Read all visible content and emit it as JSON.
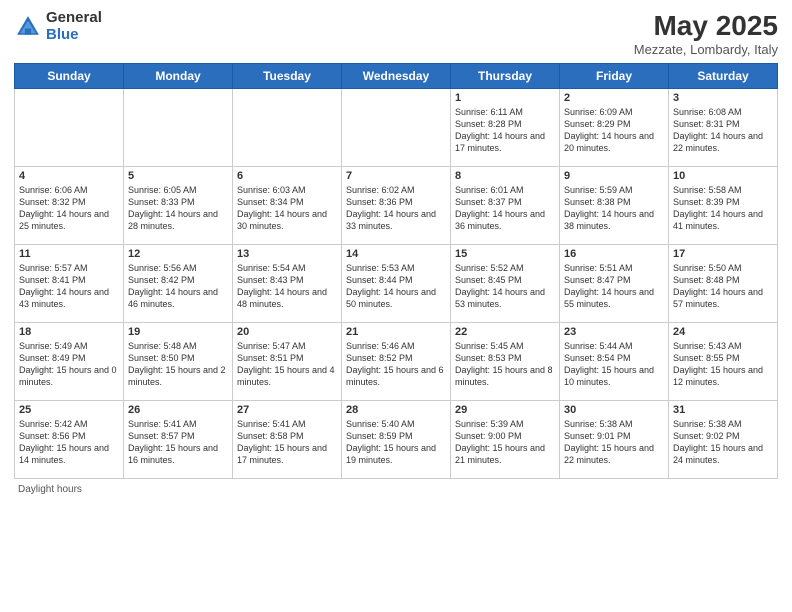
{
  "header": {
    "logo_general": "General",
    "logo_blue": "Blue",
    "main_title": "May 2025",
    "subtitle": "Mezzate, Lombardy, Italy"
  },
  "weekdays": [
    "Sunday",
    "Monday",
    "Tuesday",
    "Wednesday",
    "Thursday",
    "Friday",
    "Saturday"
  ],
  "weeks": [
    [
      {
        "day": "",
        "info": ""
      },
      {
        "day": "",
        "info": ""
      },
      {
        "day": "",
        "info": ""
      },
      {
        "day": "",
        "info": ""
      },
      {
        "day": "1",
        "info": "Sunrise: 6:11 AM\nSunset: 8:28 PM\nDaylight: 14 hours and 17 minutes."
      },
      {
        "day": "2",
        "info": "Sunrise: 6:09 AM\nSunset: 8:29 PM\nDaylight: 14 hours and 20 minutes."
      },
      {
        "day": "3",
        "info": "Sunrise: 6:08 AM\nSunset: 8:31 PM\nDaylight: 14 hours and 22 minutes."
      }
    ],
    [
      {
        "day": "4",
        "info": "Sunrise: 6:06 AM\nSunset: 8:32 PM\nDaylight: 14 hours and 25 minutes."
      },
      {
        "day": "5",
        "info": "Sunrise: 6:05 AM\nSunset: 8:33 PM\nDaylight: 14 hours and 28 minutes."
      },
      {
        "day": "6",
        "info": "Sunrise: 6:03 AM\nSunset: 8:34 PM\nDaylight: 14 hours and 30 minutes."
      },
      {
        "day": "7",
        "info": "Sunrise: 6:02 AM\nSunset: 8:36 PM\nDaylight: 14 hours and 33 minutes."
      },
      {
        "day": "8",
        "info": "Sunrise: 6:01 AM\nSunset: 8:37 PM\nDaylight: 14 hours and 36 minutes."
      },
      {
        "day": "9",
        "info": "Sunrise: 5:59 AM\nSunset: 8:38 PM\nDaylight: 14 hours and 38 minutes."
      },
      {
        "day": "10",
        "info": "Sunrise: 5:58 AM\nSunset: 8:39 PM\nDaylight: 14 hours and 41 minutes."
      }
    ],
    [
      {
        "day": "11",
        "info": "Sunrise: 5:57 AM\nSunset: 8:41 PM\nDaylight: 14 hours and 43 minutes."
      },
      {
        "day": "12",
        "info": "Sunrise: 5:56 AM\nSunset: 8:42 PM\nDaylight: 14 hours and 46 minutes."
      },
      {
        "day": "13",
        "info": "Sunrise: 5:54 AM\nSunset: 8:43 PM\nDaylight: 14 hours and 48 minutes."
      },
      {
        "day": "14",
        "info": "Sunrise: 5:53 AM\nSunset: 8:44 PM\nDaylight: 14 hours and 50 minutes."
      },
      {
        "day": "15",
        "info": "Sunrise: 5:52 AM\nSunset: 8:45 PM\nDaylight: 14 hours and 53 minutes."
      },
      {
        "day": "16",
        "info": "Sunrise: 5:51 AM\nSunset: 8:47 PM\nDaylight: 14 hours and 55 minutes."
      },
      {
        "day": "17",
        "info": "Sunrise: 5:50 AM\nSunset: 8:48 PM\nDaylight: 14 hours and 57 minutes."
      }
    ],
    [
      {
        "day": "18",
        "info": "Sunrise: 5:49 AM\nSunset: 8:49 PM\nDaylight: 15 hours and 0 minutes."
      },
      {
        "day": "19",
        "info": "Sunrise: 5:48 AM\nSunset: 8:50 PM\nDaylight: 15 hours and 2 minutes."
      },
      {
        "day": "20",
        "info": "Sunrise: 5:47 AM\nSunset: 8:51 PM\nDaylight: 15 hours and 4 minutes."
      },
      {
        "day": "21",
        "info": "Sunrise: 5:46 AM\nSunset: 8:52 PM\nDaylight: 15 hours and 6 minutes."
      },
      {
        "day": "22",
        "info": "Sunrise: 5:45 AM\nSunset: 8:53 PM\nDaylight: 15 hours and 8 minutes."
      },
      {
        "day": "23",
        "info": "Sunrise: 5:44 AM\nSunset: 8:54 PM\nDaylight: 15 hours and 10 minutes."
      },
      {
        "day": "24",
        "info": "Sunrise: 5:43 AM\nSunset: 8:55 PM\nDaylight: 15 hours and 12 minutes."
      }
    ],
    [
      {
        "day": "25",
        "info": "Sunrise: 5:42 AM\nSunset: 8:56 PM\nDaylight: 15 hours and 14 minutes."
      },
      {
        "day": "26",
        "info": "Sunrise: 5:41 AM\nSunset: 8:57 PM\nDaylight: 15 hours and 16 minutes."
      },
      {
        "day": "27",
        "info": "Sunrise: 5:41 AM\nSunset: 8:58 PM\nDaylight: 15 hours and 17 minutes."
      },
      {
        "day": "28",
        "info": "Sunrise: 5:40 AM\nSunset: 8:59 PM\nDaylight: 15 hours and 19 minutes."
      },
      {
        "day": "29",
        "info": "Sunrise: 5:39 AM\nSunset: 9:00 PM\nDaylight: 15 hours and 21 minutes."
      },
      {
        "day": "30",
        "info": "Sunrise: 5:38 AM\nSunset: 9:01 PM\nDaylight: 15 hours and 22 minutes."
      },
      {
        "day": "31",
        "info": "Sunrise: 5:38 AM\nSunset: 9:02 PM\nDaylight: 15 hours and 24 minutes."
      }
    ]
  ],
  "footer": {
    "daylight_label": "Daylight hours"
  }
}
